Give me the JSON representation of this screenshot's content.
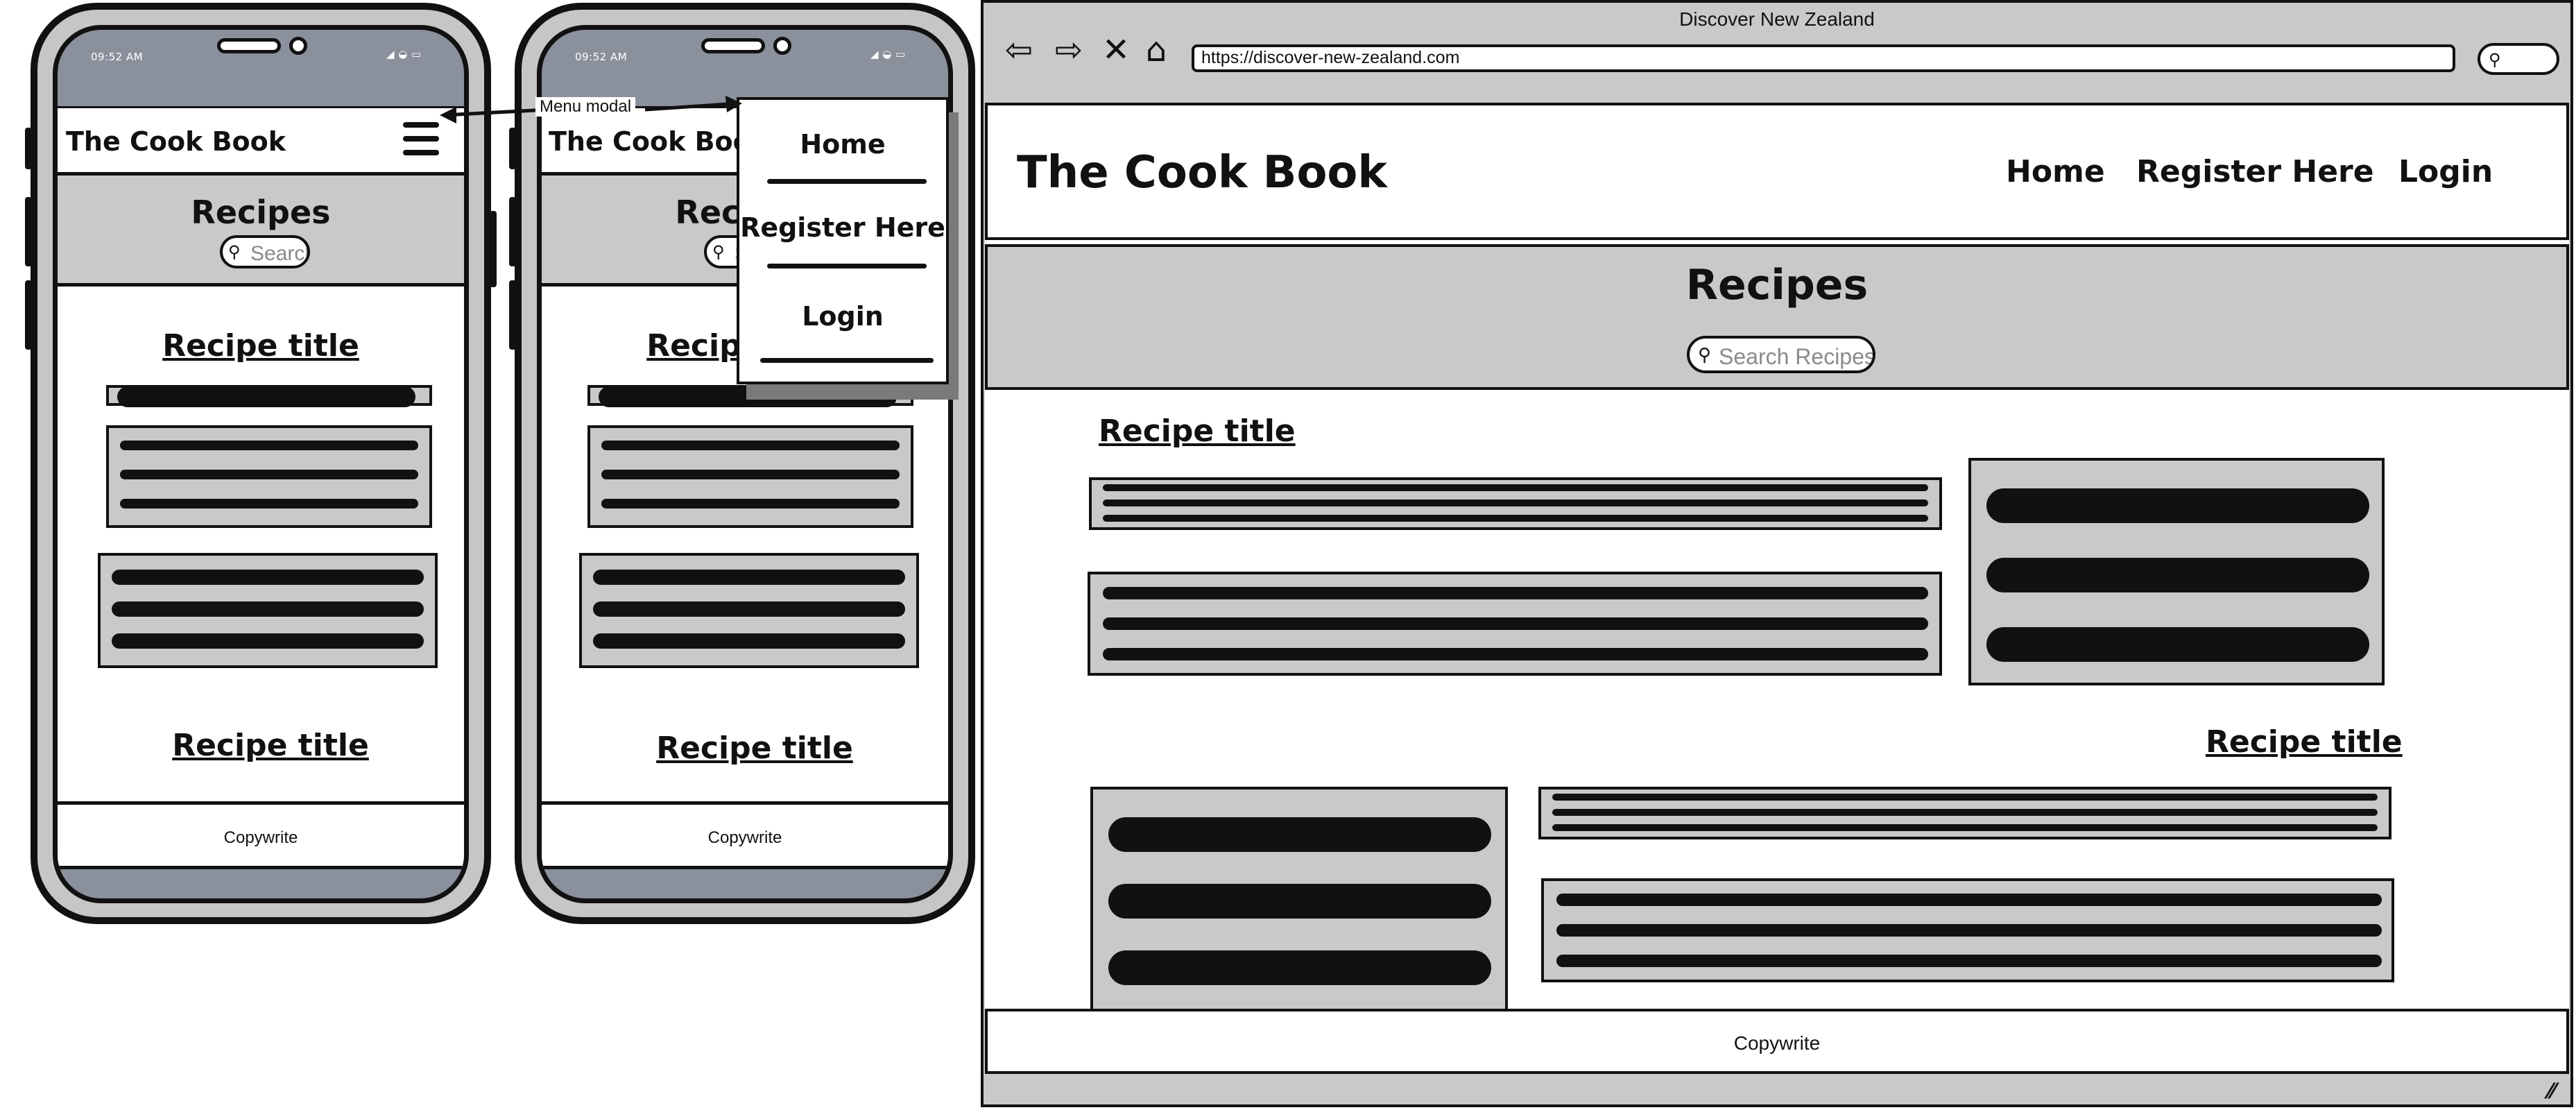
{
  "phone_status_time": "09:52 AM",
  "app_title": "The Cook Book",
  "hero_title": "Recipes",
  "mobile_search_placeholder": "Search",
  "recipe_title": "Recipe title",
  "footer_text": "Copywrite",
  "menu_items": [
    "Home",
    "Register Here",
    "Login"
  ],
  "annotation_label": "Menu modal",
  "browser": {
    "window_title": "Discover New Zealand",
    "url": "https://discover-new-zealand.com",
    "nav_links": [
      "Home",
      "Register Here",
      "Login"
    ],
    "search_placeholder": "Search Recipes"
  },
  "icons": [
    "menu-icon",
    "search-icon",
    "back-arrow-icon",
    "forward-arrow-icon",
    "close-icon",
    "home-icon",
    "resize-grip-icon"
  ]
}
